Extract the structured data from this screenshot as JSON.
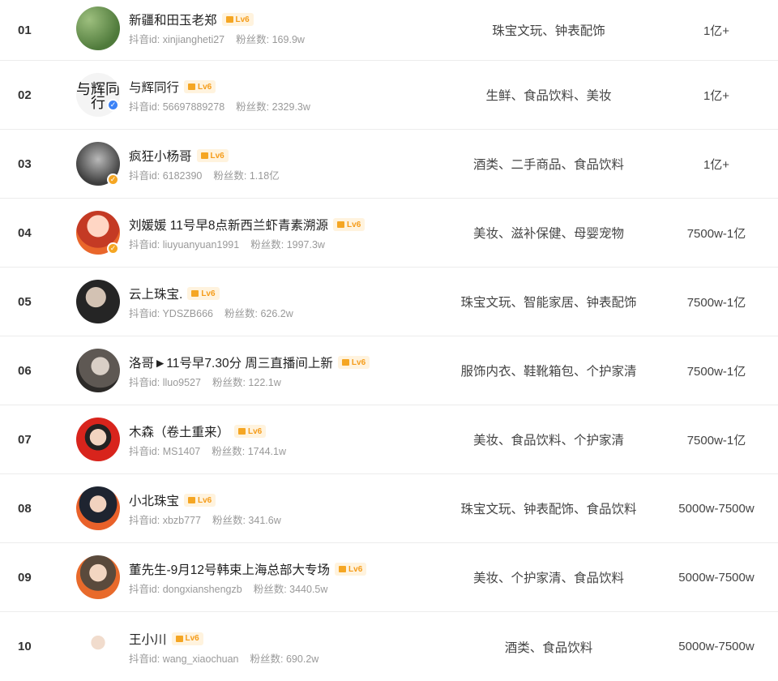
{
  "list": {
    "rows": [
      {
        "rank": "01",
        "name": "新疆和田玉老郑",
        "level": "Lv6",
        "id_label": "抖音id:",
        "id": "xinjiangheti27",
        "fans_label": "粉丝数:",
        "fans": "169.9w",
        "category": "珠宝文玩、钟表配饰",
        "sales": "1亿+"
      },
      {
        "rank": "02",
        "name": "与辉同行",
        "level": "Lv6",
        "id_label": "抖音id:",
        "id": "56697889278",
        "fans_label": "粉丝数:",
        "fans": "2329.3w",
        "category": "生鲜、食品饮料、美妆",
        "sales": "1亿+",
        "avatar_text": "与辉同行"
      },
      {
        "rank": "03",
        "name": "疯狂小杨哥",
        "level": "Lv6",
        "id_label": "抖音id:",
        "id": "6182390",
        "fans_label": "粉丝数:",
        "fans": "1.18亿",
        "category": "酒类、二手商品、食品饮料",
        "sales": "1亿+"
      },
      {
        "rank": "04",
        "name": "刘媛媛 11号早8点新西兰虾青素溯源",
        "level": "Lv6",
        "id_label": "抖音id:",
        "id": "liuyuanyuan1991",
        "fans_label": "粉丝数:",
        "fans": "1997.3w",
        "category": "美妆、滋补保健、母婴宠物",
        "sales": "7500w-1亿"
      },
      {
        "rank": "05",
        "name": "云上珠宝.",
        "level": "Lv6",
        "id_label": "抖音id:",
        "id": "YDSZB666",
        "fans_label": "粉丝数:",
        "fans": "626.2w",
        "category": "珠宝文玩、智能家居、钟表配饰",
        "sales": "7500w-1亿"
      },
      {
        "rank": "06",
        "name": "洛哥►11号早7.30分 周三直播间上新",
        "level": "Lv6",
        "id_label": "抖音id:",
        "id": "lluo9527",
        "fans_label": "粉丝数:",
        "fans": "122.1w",
        "category": "服饰内衣、鞋靴箱包、个护家清",
        "sales": "7500w-1亿"
      },
      {
        "rank": "07",
        "name": "木森（卷土重来）",
        "level": "Lv6",
        "id_label": "抖音id:",
        "id": "MS1407",
        "fans_label": "粉丝数:",
        "fans": "1744.1w",
        "category": "美妆、食品饮料、个护家清",
        "sales": "7500w-1亿"
      },
      {
        "rank": "08",
        "name": "小北珠宝",
        "level": "Lv6",
        "id_label": "抖音id:",
        "id": "xbzb777",
        "fans_label": "粉丝数:",
        "fans": "341.6w",
        "category": "珠宝文玩、钟表配饰、食品饮料",
        "sales": "5000w-7500w"
      },
      {
        "rank": "09",
        "name": "董先生-9月12号韩束上海总部大专场",
        "level": "Lv6",
        "id_label": "抖音id:",
        "id": "dongxianshengzb",
        "fans_label": "粉丝数:",
        "fans": "3440.5w",
        "category": "美妆、个护家清、食品饮料",
        "sales": "5000w-7500w"
      },
      {
        "rank": "10",
        "name": "王小川",
        "level": "Lv6",
        "id_label": "抖音id:",
        "id": "wang_xiaochuan",
        "fans_label": "粉丝数:",
        "fans": "690.2w",
        "category": "酒类、食品饮料",
        "sales": "5000w-7500w"
      }
    ]
  },
  "colors": {
    "level_badge_text": "#f59c1a",
    "level_badge_bg": "#fff3de",
    "verified_blue": "#3b82f6",
    "verified_gold": "#f5a623"
  }
}
